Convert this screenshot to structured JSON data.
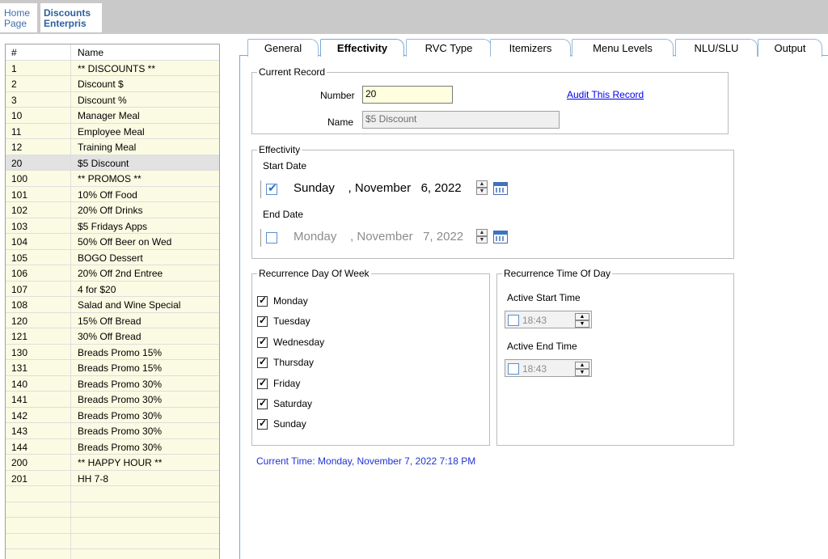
{
  "breadcrumb": {
    "home_line1": "Home",
    "home_line2": "Page",
    "current_line1": "Discounts",
    "current_line2": "Enterpris"
  },
  "grid": {
    "columns": [
      "#",
      "Name"
    ],
    "selected_index": 6,
    "rows": [
      {
        "num": "1",
        "name": "** DISCOUNTS **"
      },
      {
        "num": "2",
        "name": "Discount $"
      },
      {
        "num": "3",
        "name": "Discount %"
      },
      {
        "num": "10",
        "name": "Manager Meal"
      },
      {
        "num": "11",
        "name": "Employee Meal"
      },
      {
        "num": "12",
        "name": "Training Meal"
      },
      {
        "num": "20",
        "name": "$5 Discount"
      },
      {
        "num": "100",
        "name": "** PROMOS **"
      },
      {
        "num": "101",
        "name": "10% Off Food"
      },
      {
        "num": "102",
        "name": "20% Off Drinks"
      },
      {
        "num": "103",
        "name": "$5 Fridays Apps"
      },
      {
        "num": "104",
        "name": "50% Off Beer on Wed"
      },
      {
        "num": "105",
        "name": "BOGO Dessert"
      },
      {
        "num": "106",
        "name": "20% Off 2nd Entree"
      },
      {
        "num": "107",
        "name": "4 for $20"
      },
      {
        "num": "108",
        "name": "Salad and Wine Special"
      },
      {
        "num": "120",
        "name": "15% Off Bread"
      },
      {
        "num": "121",
        "name": "30% Off Bread"
      },
      {
        "num": "130",
        "name": "Breads Promo 15%"
      },
      {
        "num": "131",
        "name": "Breads Promo 15%"
      },
      {
        "num": "140",
        "name": "Breads Promo 30%"
      },
      {
        "num": "141",
        "name": "Breads Promo 30%"
      },
      {
        "num": "142",
        "name": "Breads Promo 30%"
      },
      {
        "num": "143",
        "name": "Breads Promo 30%"
      },
      {
        "num": "144",
        "name": "Breads Promo 30%"
      },
      {
        "num": "200",
        "name": "** HAPPY HOUR **"
      },
      {
        "num": "201",
        "name": "HH 7-8"
      }
    ]
  },
  "tabs": [
    {
      "label": "General"
    },
    {
      "label": "Effectivity"
    },
    {
      "label": "RVC Type"
    },
    {
      "label": "Itemizers"
    },
    {
      "label": "Menu Levels"
    },
    {
      "label": "NLU/SLU"
    },
    {
      "label": "Output"
    }
  ],
  "active_tab": "Effectivity",
  "current_record": {
    "legend": "Current Record",
    "number_label": "Number",
    "number_value": "20",
    "name_label": "Name",
    "name_value": "$5 Discount",
    "audit_link": "Audit This Record"
  },
  "effectivity": {
    "legend": "Effectivity",
    "start_label": "Start Date",
    "start_checked": true,
    "start_day": "Sunday",
    "start_rest": ", November   6, 2022",
    "end_label": "End Date",
    "end_checked": false,
    "end_day": "Monday",
    "end_rest": ", November   7, 2022"
  },
  "recurrence_dow": {
    "legend": "Recurrence Day Of Week",
    "days": [
      {
        "label": "Monday",
        "checked": true
      },
      {
        "label": "Tuesday",
        "checked": true
      },
      {
        "label": "Wednesday",
        "checked": true
      },
      {
        "label": "Thursday",
        "checked": true
      },
      {
        "label": "Friday",
        "checked": true
      },
      {
        "label": "Saturday",
        "checked": true
      },
      {
        "label": "Sunday",
        "checked": true
      }
    ]
  },
  "recurrence_tod": {
    "legend": "Recurrence Time Of Day",
    "start_label": "Active Start Time",
    "start_value": "18:43",
    "end_label": "Active End Time",
    "end_value": "18:43"
  },
  "current_time": "Current Time: Monday, November 7, 2022 7:18 PM",
  "colors": {
    "grid_bg": "#fbfbe3",
    "selected_row": "#e2e2e2",
    "link": "#0000ee",
    "current_time": "#1f33cf",
    "number_field": "#ffffe0"
  }
}
